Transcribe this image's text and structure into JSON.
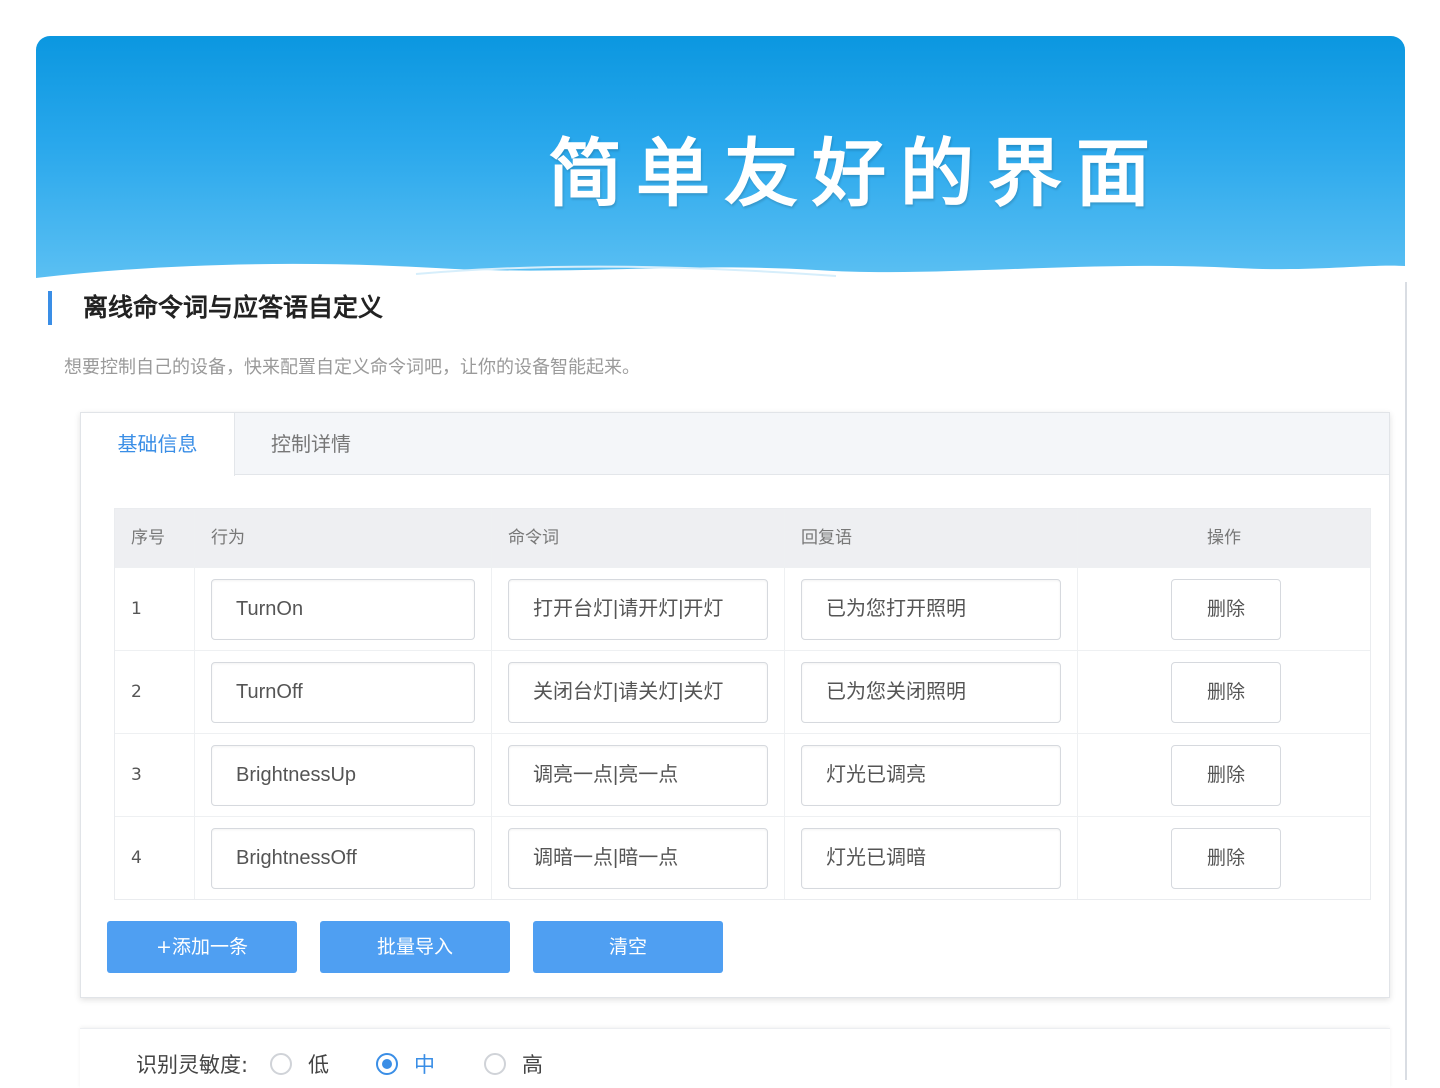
{
  "banner": {
    "title": "简单友好的界面"
  },
  "section": {
    "title": "离线命令词与应答语自定义",
    "description": "想要控制自己的设备，快来配置自定义命令词吧，让你的设备智能起来。"
  },
  "tabs": [
    {
      "label": "基础信息",
      "active": true
    },
    {
      "label": "控制详情",
      "active": false
    }
  ],
  "table": {
    "headers": [
      "序号",
      "行为",
      "命令词",
      "回复语",
      "操作"
    ],
    "rows": [
      {
        "index": "1",
        "behavior": "TurnOn",
        "command": "打开台灯|请开灯|开灯",
        "reply": "已为您打开照明",
        "action": "删除"
      },
      {
        "index": "2",
        "behavior": "TurnOff",
        "command": "关闭台灯|请关灯|关灯",
        "reply": "已为您关闭照明",
        "action": "删除"
      },
      {
        "index": "3",
        "behavior": "BrightnessUp",
        "command": "调亮一点|亮一点",
        "reply": "灯光已调亮",
        "action": "删除"
      },
      {
        "index": "4",
        "behavior": "BrightnessOff",
        "command": "调暗一点|暗一点",
        "reply": "灯光已调暗",
        "action": "删除"
      }
    ]
  },
  "buttons": {
    "add": "+添加一条",
    "import": "批量导入",
    "clear": "清空"
  },
  "sensitivity": {
    "label": "识别灵敏度:",
    "options": [
      "低",
      "中",
      "高"
    ],
    "selected": "中"
  },
  "colors": {
    "accent": "#3a8ee6",
    "button": "#4f9ff2",
    "banner": "#0b97e0"
  }
}
